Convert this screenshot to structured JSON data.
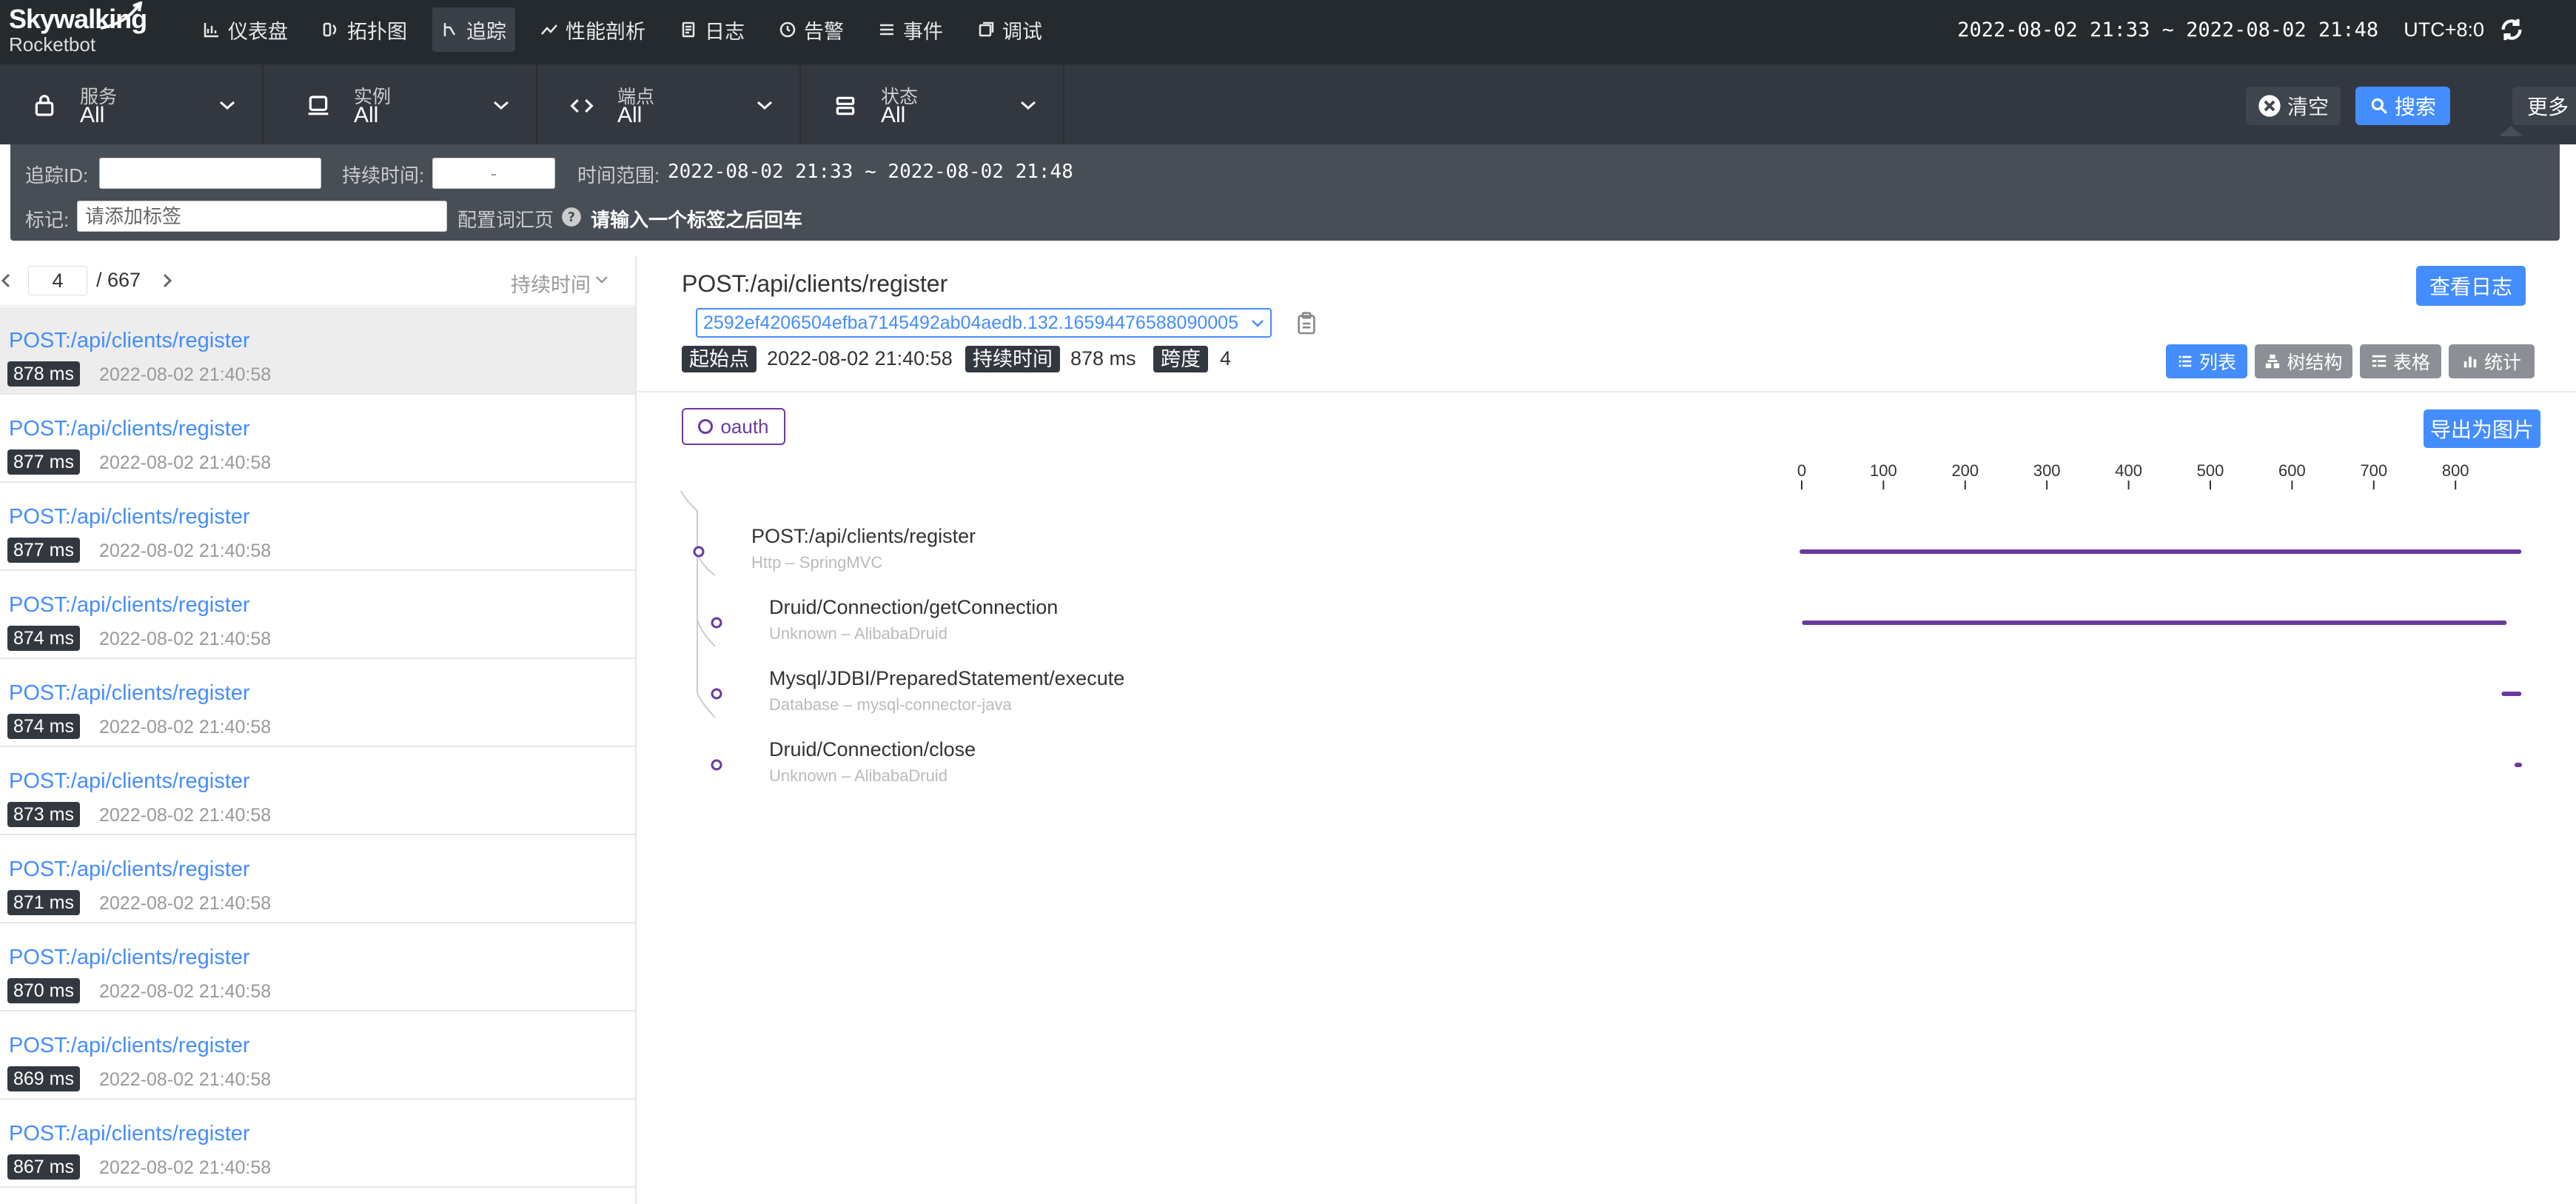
{
  "brand": {
    "line1": "Skywalking",
    "line2": "Rocketbot"
  },
  "nav": [
    {
      "label": "仪表盘",
      "icon": "dashboard-icon"
    },
    {
      "label": "拓扑图",
      "icon": "topology-icon"
    },
    {
      "label": "追踪",
      "icon": "trace-icon",
      "active": true
    },
    {
      "label": "性能剖析",
      "icon": "profile-icon"
    },
    {
      "label": "日志",
      "icon": "log-icon"
    },
    {
      "label": "告警",
      "icon": "alarm-icon"
    },
    {
      "label": "事件",
      "icon": "event-icon"
    },
    {
      "label": "调试",
      "icon": "debug-icon"
    }
  ],
  "header": {
    "time_range": "2022-08-02 21:33 ~ 2022-08-02 21:48",
    "timezone": "UTC+8:0"
  },
  "filters": [
    {
      "label": "服务",
      "value": "All",
      "icon": "service-icon"
    },
    {
      "label": "实例",
      "value": "All",
      "icon": "instance-icon"
    },
    {
      "label": "端点",
      "value": "All",
      "icon": "endpoint-icon"
    },
    {
      "label": "状态",
      "value": "All",
      "icon": "status-icon"
    }
  ],
  "actions": {
    "clear": "清空",
    "search": "搜索",
    "more": "更多"
  },
  "more_panel": {
    "trace_id_label": "追踪ID:",
    "trace_id_value": "",
    "duration_label": "持续时间:",
    "duration_value": "-",
    "time_range_label": "时间范围:",
    "time_range_value": "2022-08-02 21:33 ~ 2022-08-02 21:48",
    "tags_label": "标记:",
    "tags_placeholder": "请添加标签",
    "config_link": "配置词汇页",
    "tags_hint": "请输入一个标签之后回车"
  },
  "pager": {
    "page": "4",
    "total": "/ 667",
    "sort_label": "持续时间"
  },
  "trace_list": [
    {
      "name": "POST:/api/clients/register",
      "duration": "878 ms",
      "time": "2022-08-02 21:40:58",
      "selected": true
    },
    {
      "name": "POST:/api/clients/register",
      "duration": "877 ms",
      "time": "2022-08-02 21:40:58"
    },
    {
      "name": "POST:/api/clients/register",
      "duration": "877 ms",
      "time": "2022-08-02 21:40:58"
    },
    {
      "name": "POST:/api/clients/register",
      "duration": "874 ms",
      "time": "2022-08-02 21:40:58"
    },
    {
      "name": "POST:/api/clients/register",
      "duration": "874 ms",
      "time": "2022-08-02 21:40:58"
    },
    {
      "name": "POST:/api/clients/register",
      "duration": "873 ms",
      "time": "2022-08-02 21:40:58"
    },
    {
      "name": "POST:/api/clients/register",
      "duration": "871 ms",
      "time": "2022-08-02 21:40:58"
    },
    {
      "name": "POST:/api/clients/register",
      "duration": "870 ms",
      "time": "2022-08-02 21:40:58"
    },
    {
      "name": "POST:/api/clients/register",
      "duration": "869 ms",
      "time": "2022-08-02 21:40:58"
    },
    {
      "name": "POST:/api/clients/register",
      "duration": "867 ms",
      "time": "2022-08-02 21:40:58"
    }
  ],
  "detail": {
    "title": "POST:/api/clients/register",
    "view_logs": "查看日志",
    "trace_id": "2592ef4206504efba7145492ab04aedb.132.16594476588090005",
    "start_label": "起始点",
    "start_value": "2022-08-02 21:40:58",
    "duration_label": "持续时间",
    "duration_value": "878 ms",
    "spans_label": "跨度",
    "spans_value": "4",
    "views": [
      {
        "label": "列表",
        "icon": "list-icon",
        "active": true
      },
      {
        "label": "树结构",
        "icon": "tree-icon"
      },
      {
        "label": "表格",
        "icon": "table-icon"
      },
      {
        "label": "统计",
        "icon": "stats-icon"
      }
    ],
    "service_tag": "oauth",
    "export": "导出为图片"
  },
  "timeline": {
    "axis_ticks": [
      0,
      100,
      200,
      300,
      400,
      500,
      600,
      700,
      800
    ],
    "axis_max": 878,
    "bar_color": "#6a3aa0",
    "spans": [
      {
        "name": "POST:/api/clients/register",
        "sub": "Http – SpringMVC",
        "depth": 0,
        "start": 0,
        "end": 878
      },
      {
        "name": "Druid/Connection/getConnection",
        "sub": "Unknown – AlibabaDruid",
        "depth": 1,
        "start": 3,
        "end": 860
      },
      {
        "name": "Mysql/JDBI/PreparedStatement/execute",
        "sub": "Database – mysql-connector-java",
        "depth": 1,
        "start": 859,
        "end": 878
      },
      {
        "name": "Druid/Connection/close",
        "sub": "Unknown – AlibabaDruid",
        "depth": 1,
        "start": 875,
        "end": 878
      }
    ]
  }
}
